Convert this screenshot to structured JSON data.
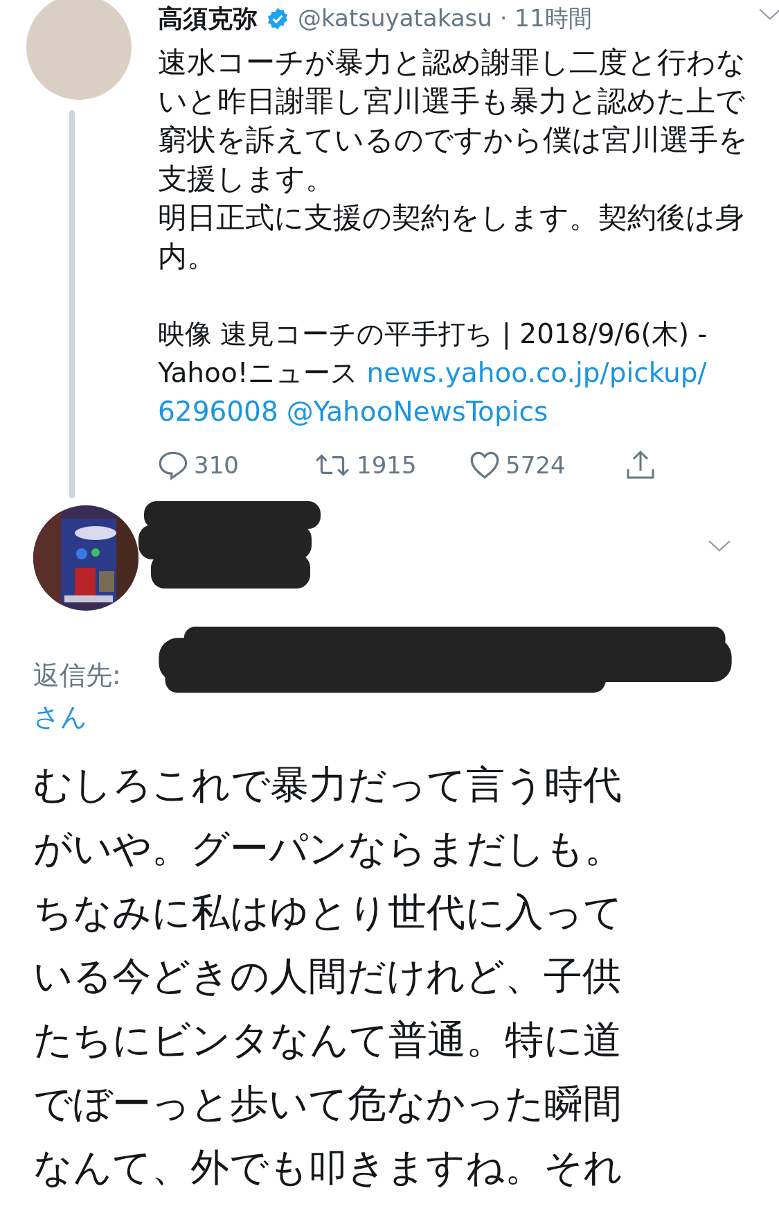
{
  "tweet": {
    "author": "高須克弥",
    "verified": true,
    "handle": "@katsuyatakasu",
    "separator": "·",
    "time": "11時間",
    "body": [
      "速水コーチが暴力と認め謝罪し二度と行わないと昨日謝罪し宮川選手も暴力と認めた上で窮状を訴えているのですから僕は宮川選手を支援します。",
      "明日正式に支援の契約をします。契約後は身内。"
    ],
    "link_title_lines": [
      "映像 速見コーチの平手打ち | 2018/9/6(木) -",
      "Yahoo!ニュース"
    ],
    "url_lines": [
      "news.yahoo.co.jp/pickup/",
      "6296008"
    ],
    "mention": "@YahooNewsTopics",
    "actions": [
      {
        "kind": "reply",
        "count": "310"
      },
      {
        "kind": "retweet",
        "count": "1915"
      },
      {
        "kind": "like",
        "count": "5724"
      },
      {
        "kind": "share"
      }
    ]
  },
  "reply": {
    "redacted": true,
    "reply_to_label": "返信先:",
    "reply_to_suffix": "さん",
    "body": "むしろこれで暴力だって言う時代がいや。グーパンならまだしも。ちなみに私はゆとり世代に入っている今どきの人間だけれど、子供たちにビンタなんて普通。特に道でぼーっと歩いて危なかった瞬間なんて、外でも叩きますね。それ"
  }
}
